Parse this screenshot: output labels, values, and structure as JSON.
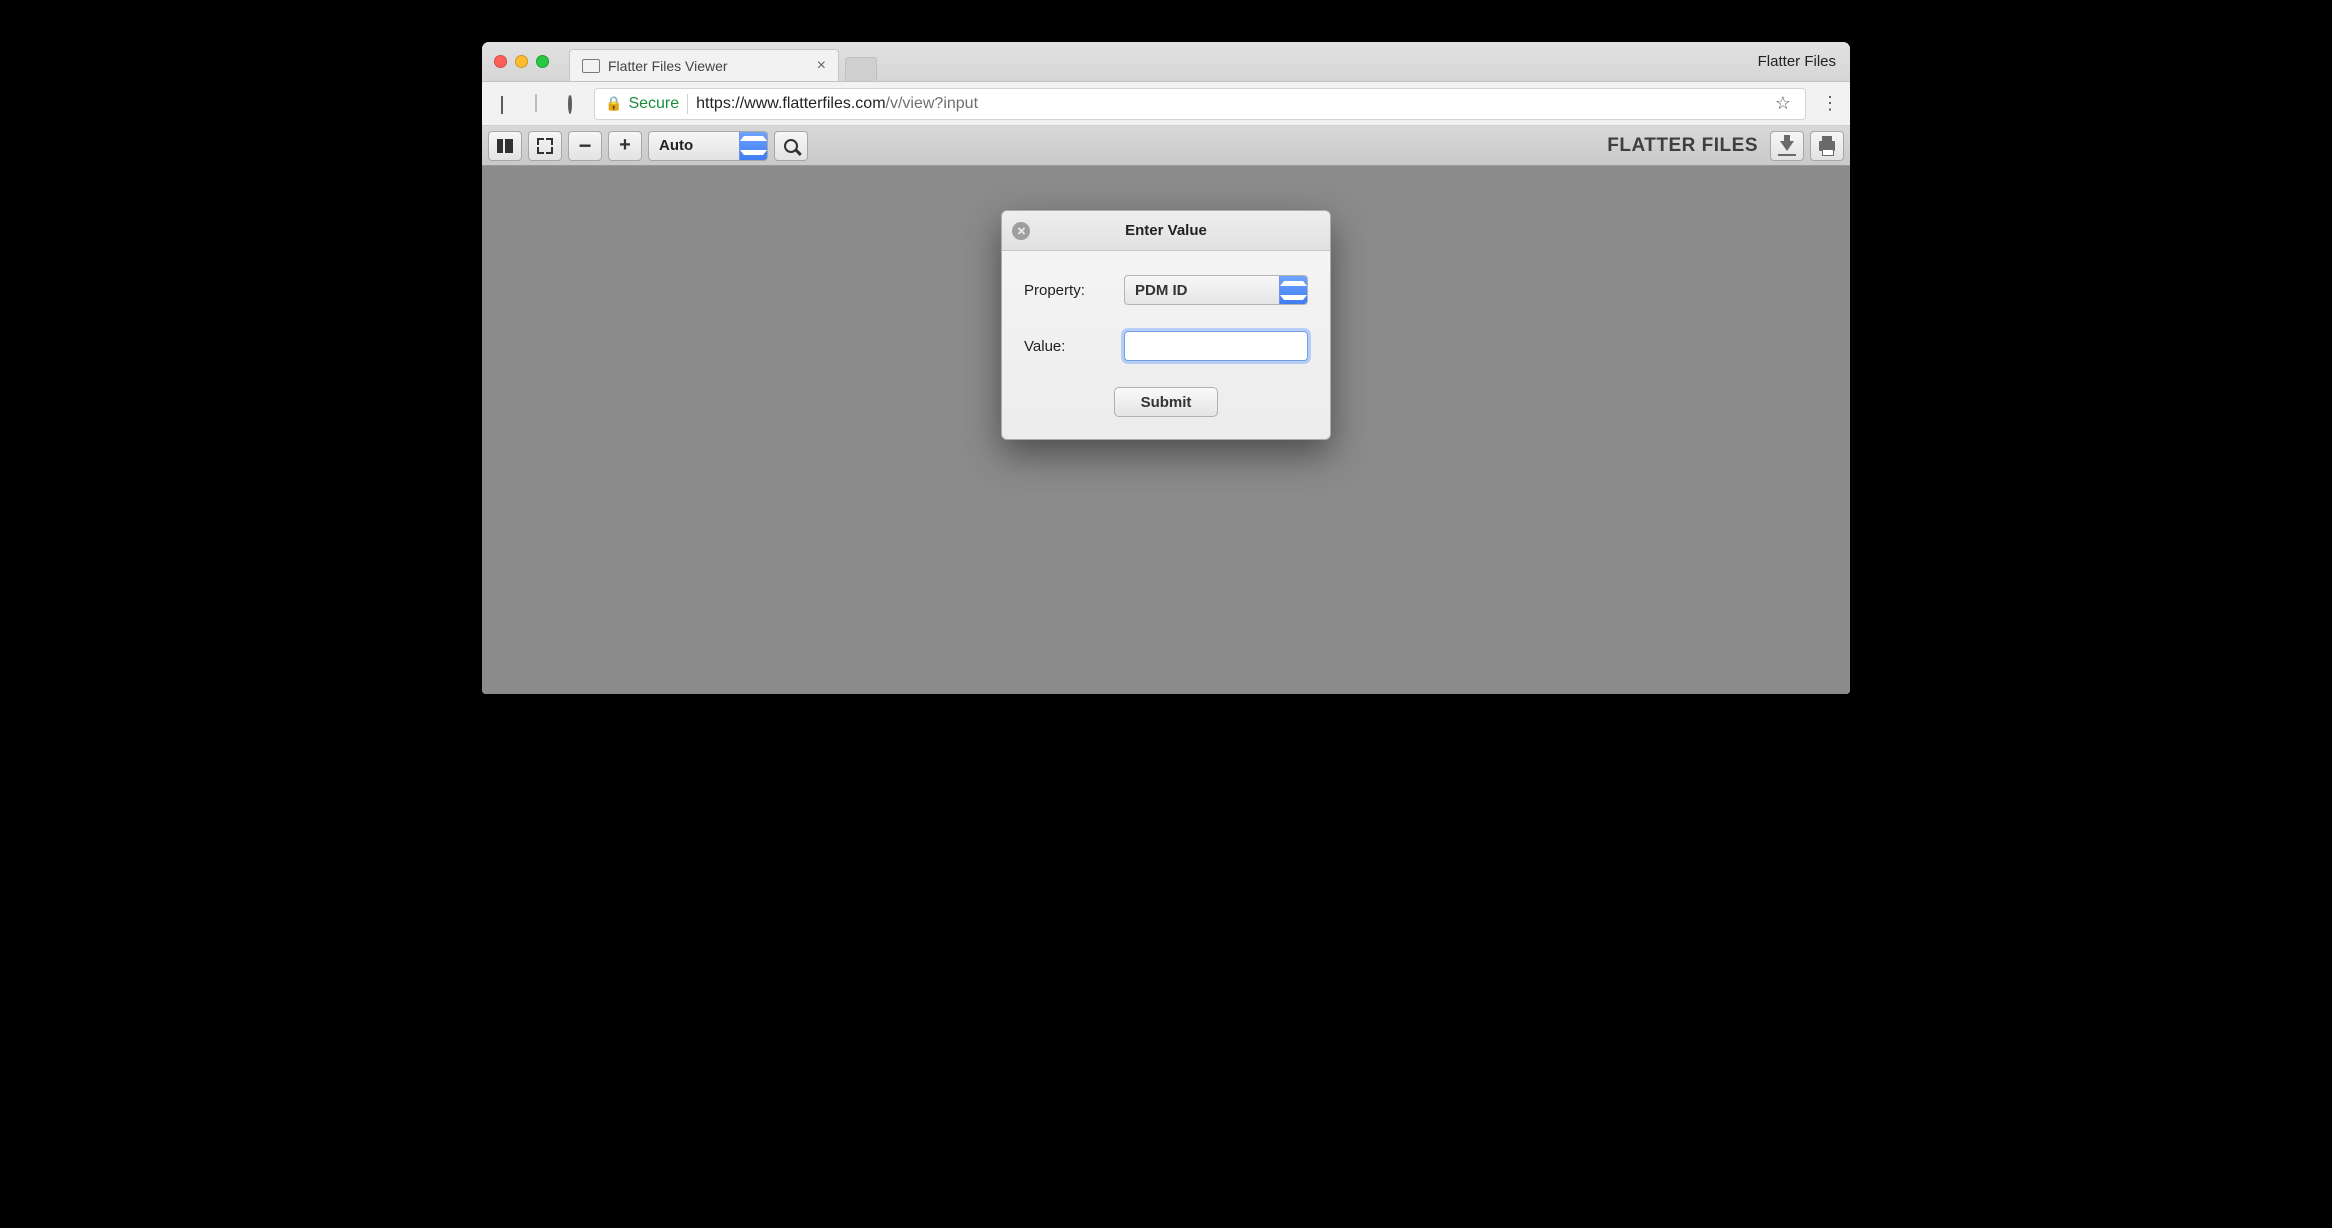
{
  "window": {
    "menu_title": "Flatter Files"
  },
  "tab": {
    "title": "Flatter Files Viewer"
  },
  "nav": {
    "secure_label": "Secure",
    "url_scheme_host": "https://www.flatterfiles.com",
    "url_path": "/v/view?input"
  },
  "toolbar": {
    "zoom_label": "Auto",
    "brand": "FLATTER FILES"
  },
  "dialog": {
    "title": "Enter Value",
    "property_label": "Property:",
    "property_value": "PDM ID",
    "value_label": "Value:",
    "value_input": "",
    "submit_label": "Submit"
  }
}
